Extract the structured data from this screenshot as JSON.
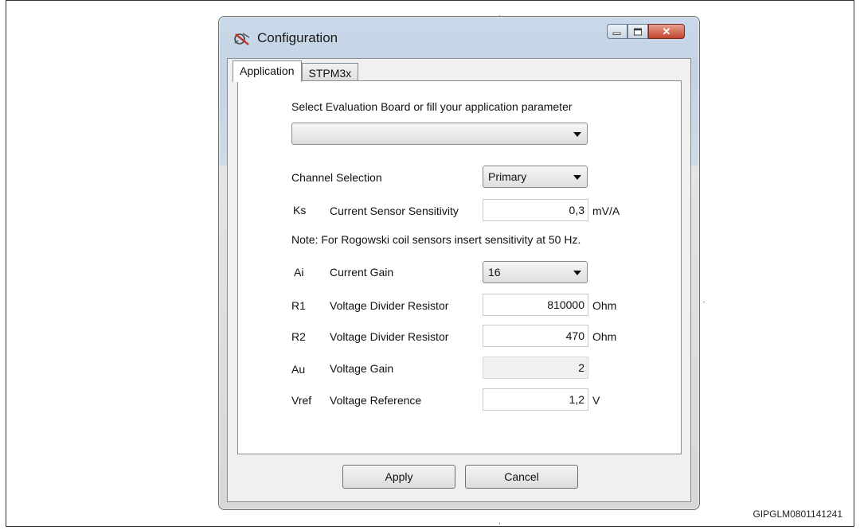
{
  "window": {
    "title": "Configuration",
    "close_glyph": "✕"
  },
  "tabs": [
    {
      "label": "Application",
      "active": true
    },
    {
      "label": "STPM3x",
      "active": false
    }
  ],
  "application": {
    "board_prompt": "Select Evaluation Board or fill your application parameter",
    "board_value": "",
    "channel_label": "Channel Selection",
    "channel_value": "Primary",
    "ks": {
      "symbol": "Ks",
      "label": "Current Sensor Sensitivity",
      "value": "0,3",
      "unit": "mV/A"
    },
    "note": "Note: For Rogowski coil sensors insert sensitivity at 50 Hz.",
    "ai": {
      "symbol": "Ai",
      "label": "Current Gain",
      "value": "16"
    },
    "r1": {
      "symbol": "R1",
      "label": "Voltage Divider Resistor",
      "value": "810000",
      "unit": "Ohm"
    },
    "r2": {
      "symbol": "R2",
      "label": "Voltage Divider Resistor",
      "value": "470",
      "unit": "Ohm"
    },
    "au": {
      "symbol": "Au",
      "label": "Voltage Gain",
      "value": "2"
    },
    "vref": {
      "symbol": "Vref",
      "label": "Voltage Reference",
      "value": "1,2",
      "unit": "V"
    }
  },
  "buttons": {
    "apply": "Apply",
    "cancel": "Cancel"
  },
  "figure_id": "GIPGLM0801141241",
  "icons": {
    "app": "probe-icon",
    "minimize": "minimize-icon",
    "maximize": "maximize-icon",
    "close": "close-icon"
  }
}
